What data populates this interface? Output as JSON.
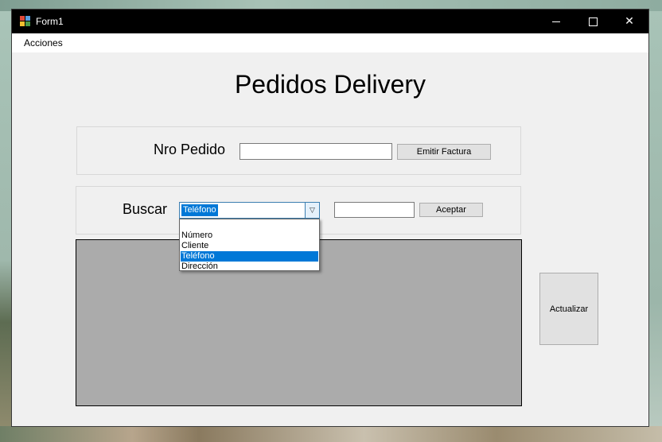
{
  "window": {
    "title": "Form1",
    "minimize_icon": "minimize-icon",
    "maximize_icon": "maximize-icon",
    "close_icon": "close-icon",
    "close_glyph": "✕"
  },
  "menu": {
    "items": [
      {
        "label": "Acciones"
      }
    ]
  },
  "main": {
    "title": "Pedidos Delivery",
    "pedido": {
      "label": "Nro Pedido",
      "input_value": "",
      "button_label": "Emitir Factura"
    },
    "buscar": {
      "label": "Buscar",
      "combo_selected": "Teléfono",
      "combo_options": [
        "",
        "Número",
        "Cliente",
        "Teléfono",
        "Dirección"
      ],
      "highlighted_index": 3,
      "input_value": "",
      "button_label": "Aceptar"
    },
    "refresh_button_label": "Actualizar"
  },
  "colors": {
    "selection": "#0078d7",
    "grid_background": "#ababab",
    "form_background": "#f0f0f0"
  }
}
